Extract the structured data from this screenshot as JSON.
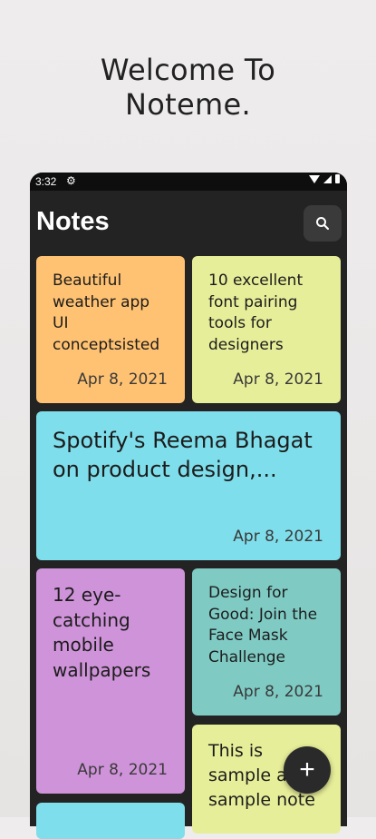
{
  "welcome": {
    "line1": "Welcome To",
    "line2": "Noteme."
  },
  "status": {
    "time": "3:32"
  },
  "appbar": {
    "title": "Notes",
    "search_icon": "search-icon"
  },
  "notes": [
    {
      "title": "Beautiful weather app UI conceptsisted",
      "date": "Apr 8, 2021",
      "color": "#ffc272"
    },
    {
      "title": "10 excellent font pairing tools for designers",
      "date": "Apr 8, 2021",
      "color": "#e7ee99"
    },
    {
      "title": "Spotify's Reema Bhagat on product design,...",
      "date": "Apr 8, 2021",
      "color": "#7fdeeb"
    },
    {
      "title": "12 eye-catching mobile wallpapers",
      "date": "Apr 8, 2021",
      "color": "#cf93d9"
    },
    {
      "title": "Design for Good: Join the Face Mask Challenge",
      "date": "Apr 8, 2021",
      "color": "#7fcbc4"
    },
    {
      "title": "This is sample a sample note",
      "date": "",
      "color": "#e7ee99"
    },
    {
      "title": "",
      "date": "",
      "color": "#7fdeeb"
    }
  ],
  "fab": {
    "label": "+"
  }
}
